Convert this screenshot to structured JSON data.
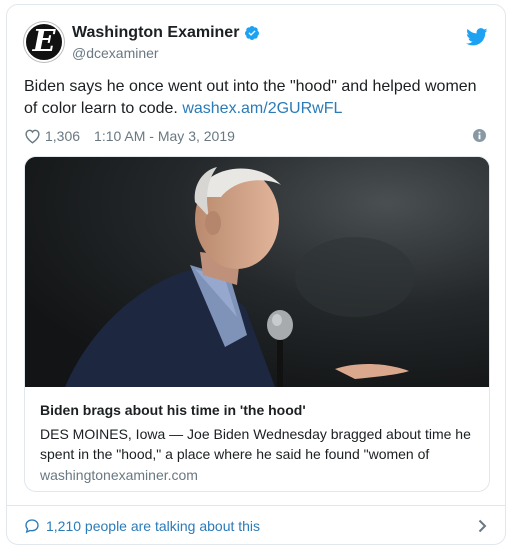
{
  "account": {
    "display_name": "Washington Examiner",
    "handle": "@dcexaminer",
    "avatar_letter": "E",
    "verified": true
  },
  "tweet": {
    "text": "Biden says he once went out into the \"hood\" and helped women of color learn to code.",
    "link_text": "washex.am/2GURwFL",
    "like_count": "1,306",
    "timestamp": "1:10 AM - May 3, 2019"
  },
  "card": {
    "title": "Biden brags about his time in 'the hood'",
    "description": "DES MOINES, Iowa — Joe Biden Wednesday bragged about time he spent in the \"hood,\" a place where he said he found \"women of",
    "domain": "washingtonexaminer.com"
  },
  "footer": {
    "conversation_text": "1,210 people are talking about this"
  },
  "colors": {
    "brand_blue": "#1da1f2",
    "link": "#2b7bb9",
    "text": "#1c2022",
    "muted": "#697882",
    "border": "#e1e8ed"
  },
  "icons": [
    "verified-icon",
    "twitter-icon",
    "heart-icon",
    "info-icon",
    "comment-icon",
    "chevron-right-icon"
  ]
}
